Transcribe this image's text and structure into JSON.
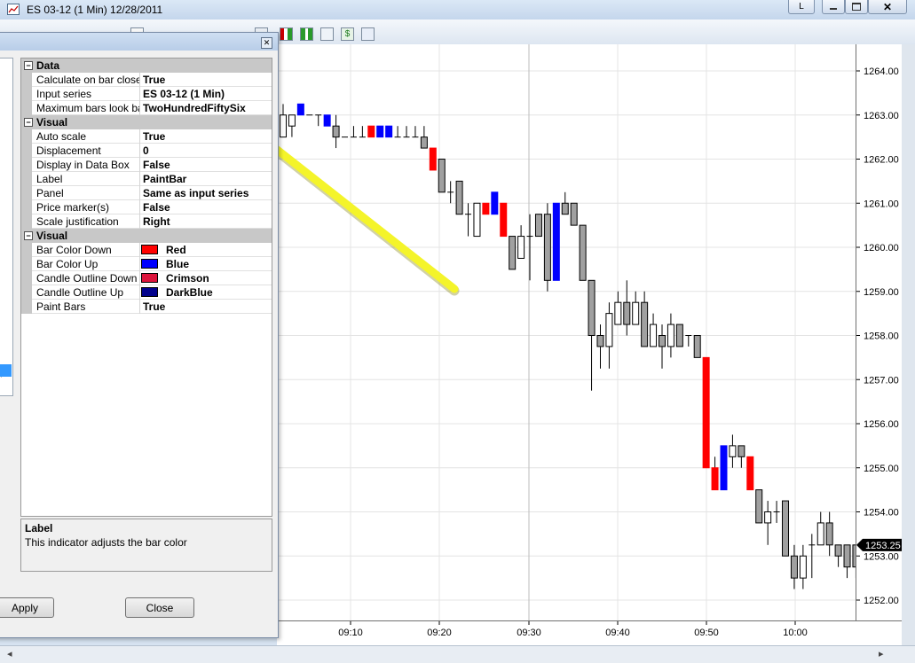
{
  "window": {
    "title": "ES 03-12 (1 Min)  12/28/2011",
    "link_button": "L"
  },
  "dialog": {
    "categories": [
      {
        "title": "Data",
        "props": [
          {
            "name": "Calculate on bar close",
            "value": "True"
          },
          {
            "name": "Input series",
            "value": "ES 03-12 (1 Min)"
          },
          {
            "name": "Maximum bars look back",
            "value": "TwoHundredFiftySix"
          }
        ]
      },
      {
        "title": "Visual",
        "props": [
          {
            "name": "Auto scale",
            "value": "True"
          },
          {
            "name": "Displacement",
            "value": "0"
          },
          {
            "name": "Display in Data Box",
            "value": "False"
          },
          {
            "name": "Label",
            "value": "PaintBar"
          },
          {
            "name": "Panel",
            "value": "Same as input series"
          },
          {
            "name": "Price marker(s)",
            "value": "False"
          },
          {
            "name": "Scale justification",
            "value": "Right"
          }
        ]
      },
      {
        "title": "Visual",
        "props": [
          {
            "name": "Bar Color Down",
            "value": "Red",
            "color": "#ff0000"
          },
          {
            "name": "Bar Color Up",
            "value": "Blue",
            "color": "#0000ff"
          },
          {
            "name": "Candle Outline Down",
            "value": "Crimson",
            "color": "#dc143c"
          },
          {
            "name": "Candle Outline Up",
            "value": "DarkBlue",
            "color": "#00008b"
          },
          {
            "name": "Paint Bars",
            "value": "True"
          }
        ]
      }
    ],
    "help": {
      "title": "Label",
      "description": "This indicator adjusts the bar color"
    },
    "apply_label": "Apply",
    "close_label": "Close"
  },
  "chart_data": {
    "type": "candlestick",
    "instrument": "ES 03-12 (1 Min)",
    "date": "12/28/2011",
    "y_ticks": [
      "1264.00",
      "1263.00",
      "1262.00",
      "1261.00",
      "1260.00",
      "1259.00",
      "1258.00",
      "1257.00",
      "1256.00",
      "1255.00",
      "1254.00",
      "1253.00",
      "1252.00"
    ],
    "x_ticks": [
      "09:10",
      "09:20",
      "09:30",
      "09:40",
      "09:50",
      "10:00"
    ],
    "ylim": [
      1251.5,
      1264.25
    ],
    "last_price": "1253.25",
    "colors": {
      "up": "#0000ff",
      "down": "#ff0000",
      "neutral_down": "#a0a0a0",
      "neutral_up": "#ffffff"
    },
    "bars": [
      {
        "o": 1263.0,
        "h": 1263.25,
        "l": 1262.5,
        "c": 1262.5,
        "p": "u"
      },
      {
        "o": 1262.75,
        "h": 1263.0,
        "l": 1262.5,
        "c": 1263.0,
        "p": "u"
      },
      {
        "o": 1263.0,
        "h": 1263.25,
        "l": 1263.0,
        "c": 1263.25,
        "p": "U"
      },
      {
        "o": 1263.0,
        "h": 1263.0,
        "l": 1263.0,
        "c": 1263.0,
        "p": "d"
      },
      {
        "o": 1263.0,
        "h": 1263.0,
        "l": 1262.75,
        "c": 1263.0,
        "p": "d"
      },
      {
        "o": 1263.0,
        "h": 1263.0,
        "l": 1262.75,
        "c": 1262.75,
        "p": "U"
      },
      {
        "o": 1262.75,
        "h": 1263.0,
        "l": 1262.25,
        "c": 1262.5,
        "p": "d"
      },
      {
        "o": 1262.5,
        "h": 1262.5,
        "l": 1262.5,
        "c": 1262.5,
        "p": "d"
      },
      {
        "o": 1262.5,
        "h": 1262.75,
        "l": 1262.5,
        "c": 1262.5,
        "p": "d"
      },
      {
        "o": 1262.5,
        "h": 1262.75,
        "l": 1262.5,
        "c": 1262.5,
        "p": "d"
      },
      {
        "o": 1262.5,
        "h": 1262.75,
        "l": 1262.5,
        "c": 1262.75,
        "p": "D"
      },
      {
        "o": 1262.5,
        "h": 1262.75,
        "l": 1262.5,
        "c": 1262.75,
        "p": "U"
      },
      {
        "o": 1262.5,
        "h": 1262.75,
        "l": 1262.5,
        "c": 1262.75,
        "p": "U"
      },
      {
        "o": 1262.5,
        "h": 1262.75,
        "l": 1262.5,
        "c": 1262.5,
        "p": "d"
      },
      {
        "o": 1262.5,
        "h": 1262.75,
        "l": 1262.5,
        "c": 1262.5,
        "p": "d"
      },
      {
        "o": 1262.5,
        "h": 1262.75,
        "l": 1262.5,
        "c": 1262.5,
        "p": "d"
      },
      {
        "o": 1262.5,
        "h": 1262.75,
        "l": 1262.25,
        "c": 1262.25,
        "p": "d"
      },
      {
        "o": 1262.25,
        "h": 1262.25,
        "l": 1261.75,
        "c": 1261.75,
        "p": "D"
      },
      {
        "o": 1262.0,
        "h": 1262.0,
        "l": 1261.25,
        "c": 1261.25,
        "p": "d"
      },
      {
        "o": 1261.25,
        "h": 1261.5,
        "l": 1261.0,
        "c": 1261.25,
        "p": "u"
      },
      {
        "o": 1261.5,
        "h": 1261.5,
        "l": 1260.75,
        "c": 1260.75,
        "p": "d"
      },
      {
        "o": 1260.75,
        "h": 1261.0,
        "l": 1260.25,
        "c": 1260.75,
        "p": "d"
      },
      {
        "o": 1260.25,
        "h": 1261.0,
        "l": 1260.25,
        "c": 1261.0,
        "p": "u"
      },
      {
        "o": 1260.75,
        "h": 1261.0,
        "l": 1260.75,
        "c": 1261.0,
        "p": "D"
      },
      {
        "o": 1260.75,
        "h": 1261.25,
        "l": 1260.75,
        "c": 1261.25,
        "p": "U"
      },
      {
        "o": 1261.0,
        "h": 1261.0,
        "l": 1260.25,
        "c": 1260.25,
        "p": "D"
      },
      {
        "o": 1260.25,
        "h": 1260.25,
        "l": 1259.5,
        "c": 1259.5,
        "p": "d"
      },
      {
        "o": 1259.75,
        "h": 1260.5,
        "l": 1259.75,
        "c": 1260.25,
        "p": "u"
      },
      {
        "o": 1260.25,
        "h": 1260.75,
        "l": 1259.25,
        "c": 1260.25,
        "p": "u"
      },
      {
        "o": 1260.25,
        "h": 1260.75,
        "l": 1260.25,
        "c": 1260.75,
        "p": "d"
      },
      {
        "o": 1260.75,
        "h": 1261.0,
        "l": 1259.0,
        "c": 1259.25,
        "p": "d"
      },
      {
        "o": 1259.25,
        "h": 1261.0,
        "l": 1259.25,
        "c": 1261.0,
        "p": "U"
      },
      {
        "o": 1261.0,
        "h": 1261.25,
        "l": 1260.75,
        "c": 1260.75,
        "p": "d"
      },
      {
        "o": 1261.0,
        "h": 1261.0,
        "l": 1260.5,
        "c": 1260.5,
        "p": "d"
      },
      {
        "o": 1260.5,
        "h": 1260.5,
        "l": 1259.25,
        "c": 1259.25,
        "p": "d"
      },
      {
        "o": 1259.25,
        "h": 1259.25,
        "l": 1256.75,
        "c": 1258.0,
        "p": "d"
      },
      {
        "o": 1257.75,
        "h": 1258.25,
        "l": 1257.25,
        "c": 1258.0,
        "p": "d"
      },
      {
        "o": 1257.75,
        "h": 1258.75,
        "l": 1257.25,
        "c": 1258.5,
        "p": "u"
      },
      {
        "o": 1258.25,
        "h": 1259.0,
        "l": 1258.25,
        "c": 1258.75,
        "p": "u"
      },
      {
        "o": 1258.75,
        "h": 1259.25,
        "l": 1258.0,
        "c": 1258.25,
        "p": "d"
      },
      {
        "o": 1258.25,
        "h": 1259.0,
        "l": 1258.25,
        "c": 1258.75,
        "p": "u"
      },
      {
        "o": 1258.75,
        "h": 1259.0,
        "l": 1257.75,
        "c": 1257.75,
        "p": "d"
      },
      {
        "o": 1257.75,
        "h": 1258.5,
        "l": 1257.75,
        "c": 1258.25,
        "p": "u"
      },
      {
        "o": 1258.0,
        "h": 1258.25,
        "l": 1257.25,
        "c": 1257.75,
        "p": "d"
      },
      {
        "o": 1257.75,
        "h": 1258.5,
        "l": 1257.5,
        "c": 1258.25,
        "p": "u"
      },
      {
        "o": 1258.25,
        "h": 1258.25,
        "l": 1257.75,
        "c": 1257.75,
        "p": "d"
      },
      {
        "o": 1258.0,
        "h": 1258.0,
        "l": 1257.75,
        "c": 1258.0,
        "p": "u"
      },
      {
        "o": 1258.0,
        "h": 1258.0,
        "l": 1257.5,
        "c": 1257.5,
        "p": "d"
      },
      {
        "o": 1257.5,
        "h": 1257.5,
        "l": 1255.0,
        "c": 1255.0,
        "p": "D"
      },
      {
        "o": 1255.0,
        "h": 1255.25,
        "l": 1254.5,
        "c": 1254.5,
        "p": "D"
      },
      {
        "o": 1254.5,
        "h": 1255.5,
        "l": 1254.5,
        "c": 1255.5,
        "p": "U"
      },
      {
        "o": 1255.25,
        "h": 1255.75,
        "l": 1255.0,
        "c": 1255.5,
        "p": "u"
      },
      {
        "o": 1255.5,
        "h": 1255.5,
        "l": 1255.0,
        "c": 1255.25,
        "p": "d"
      },
      {
        "o": 1255.25,
        "h": 1255.25,
        "l": 1254.5,
        "c": 1254.5,
        "p": "D"
      },
      {
        "o": 1254.5,
        "h": 1254.5,
        "l": 1253.75,
        "c": 1253.75,
        "p": "d"
      },
      {
        "o": 1253.75,
        "h": 1254.25,
        "l": 1253.25,
        "c": 1254.0,
        "p": "u"
      },
      {
        "o": 1254.0,
        "h": 1254.25,
        "l": 1253.75,
        "c": 1254.0,
        "p": "d"
      },
      {
        "o": 1254.25,
        "h": 1254.25,
        "l": 1253.0,
        "c": 1253.0,
        "p": "d"
      },
      {
        "o": 1253.0,
        "h": 1253.25,
        "l": 1252.25,
        "c": 1252.5,
        "p": "d"
      },
      {
        "o": 1252.5,
        "h": 1253.25,
        "l": 1252.25,
        "c": 1253.0,
        "p": "u"
      },
      {
        "o": 1253.25,
        "h": 1253.5,
        "l": 1252.5,
        "c": 1253.25,
        "p": "u"
      },
      {
        "o": 1253.25,
        "h": 1254.0,
        "l": 1253.25,
        "c": 1253.75,
        "p": "u"
      },
      {
        "o": 1253.75,
        "h": 1254.0,
        "l": 1253.0,
        "c": 1253.25,
        "p": "d"
      },
      {
        "o": 1253.25,
        "h": 1253.25,
        "l": 1252.75,
        "c": 1253.0,
        "p": "d"
      },
      {
        "o": 1253.25,
        "h": 1253.25,
        "l": 1252.5,
        "c": 1252.75,
        "p": "d"
      },
      {
        "o": 1253.25,
        "h": 1253.25,
        "l": 1252.5,
        "c": 1252.75,
        "p": "d"
      },
      {
        "o": 1253.25,
        "h": 1253.5,
        "l": 1252.75,
        "c": 1253.0,
        "p": "d"
      },
      {
        "o": 1253.0,
        "h": 1253.25,
        "l": 1252.75,
        "c": 1253.25,
        "p": "u"
      },
      {
        "o": 1253.25,
        "h": 1253.25,
        "l": 1252.75,
        "c": 1253.25,
        "p": "u"
      },
      {
        "o": 1253.25,
        "h": 1253.25,
        "l": 1253.0,
        "c": 1253.25,
        "p": "u"
      }
    ]
  }
}
